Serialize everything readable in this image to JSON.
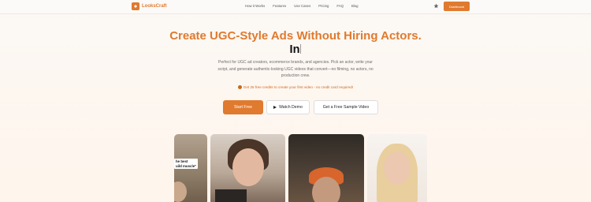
{
  "nav": {
    "logo_text": "LooksCraft",
    "links": [
      "How it Works",
      "Features",
      "Use Cases",
      "Pricing",
      "FAQ",
      "Blog"
    ],
    "star_icon": "star-icon",
    "dashboard_label": "Dashboard"
  },
  "hero": {
    "title": "Create UGC-Style Ads Without Hiring Actors.",
    "typing_text": "In",
    "description": "Perfect for UGC ad creators, ecommerce brands, and agencies. Pick an actor, write your script, and generate authentic-looking UGC videos that convert—no filming, no actors, no production crew.",
    "promo": "Get 25 free credits to create your first video - no credit card required!"
  },
  "buttons": {
    "start_free": "Start Free",
    "watch_demo": "Watch Demo",
    "sample_video": "Get a Free Sample Video"
  },
  "videos": {
    "card1_caption_line1": "he best",
    "card1_caption_line2": "uild muscle\""
  },
  "colors": {
    "accent": "#e07a2e",
    "text": "#222222"
  }
}
